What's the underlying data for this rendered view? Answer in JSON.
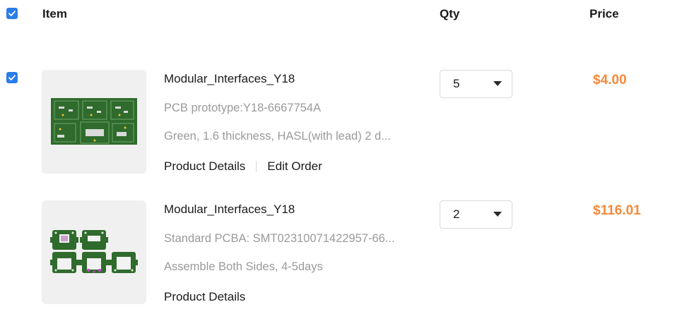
{
  "header": {
    "item_label": "Item",
    "qty_label": "Qty",
    "price_label": "Price",
    "select_all_checked": true
  },
  "items": [
    {
      "checked": true,
      "name": "Modular_Interfaces_Y18",
      "line1": "PCB prototype:Y18-6667754A",
      "line2": "Green, 1.6 thickness, HASL(with lead) 2 d...",
      "links": [
        "Product Details",
        "Edit Order"
      ],
      "qty": "5",
      "price": "$4.00"
    },
    {
      "checked": false,
      "name": "Modular_Interfaces_Y18",
      "line1": "Standard PCBA: SMT02310071422957-66...",
      "line2": "Assemble Both Sides, 4-5days",
      "links": [
        "Product Details"
      ],
      "qty": "2",
      "price": "$116.01"
    }
  ],
  "colors": {
    "accent": "#2b7de9",
    "price": "#f5893a",
    "muted": "#9a9a9a",
    "pcb_green": "#2f6b2c"
  }
}
